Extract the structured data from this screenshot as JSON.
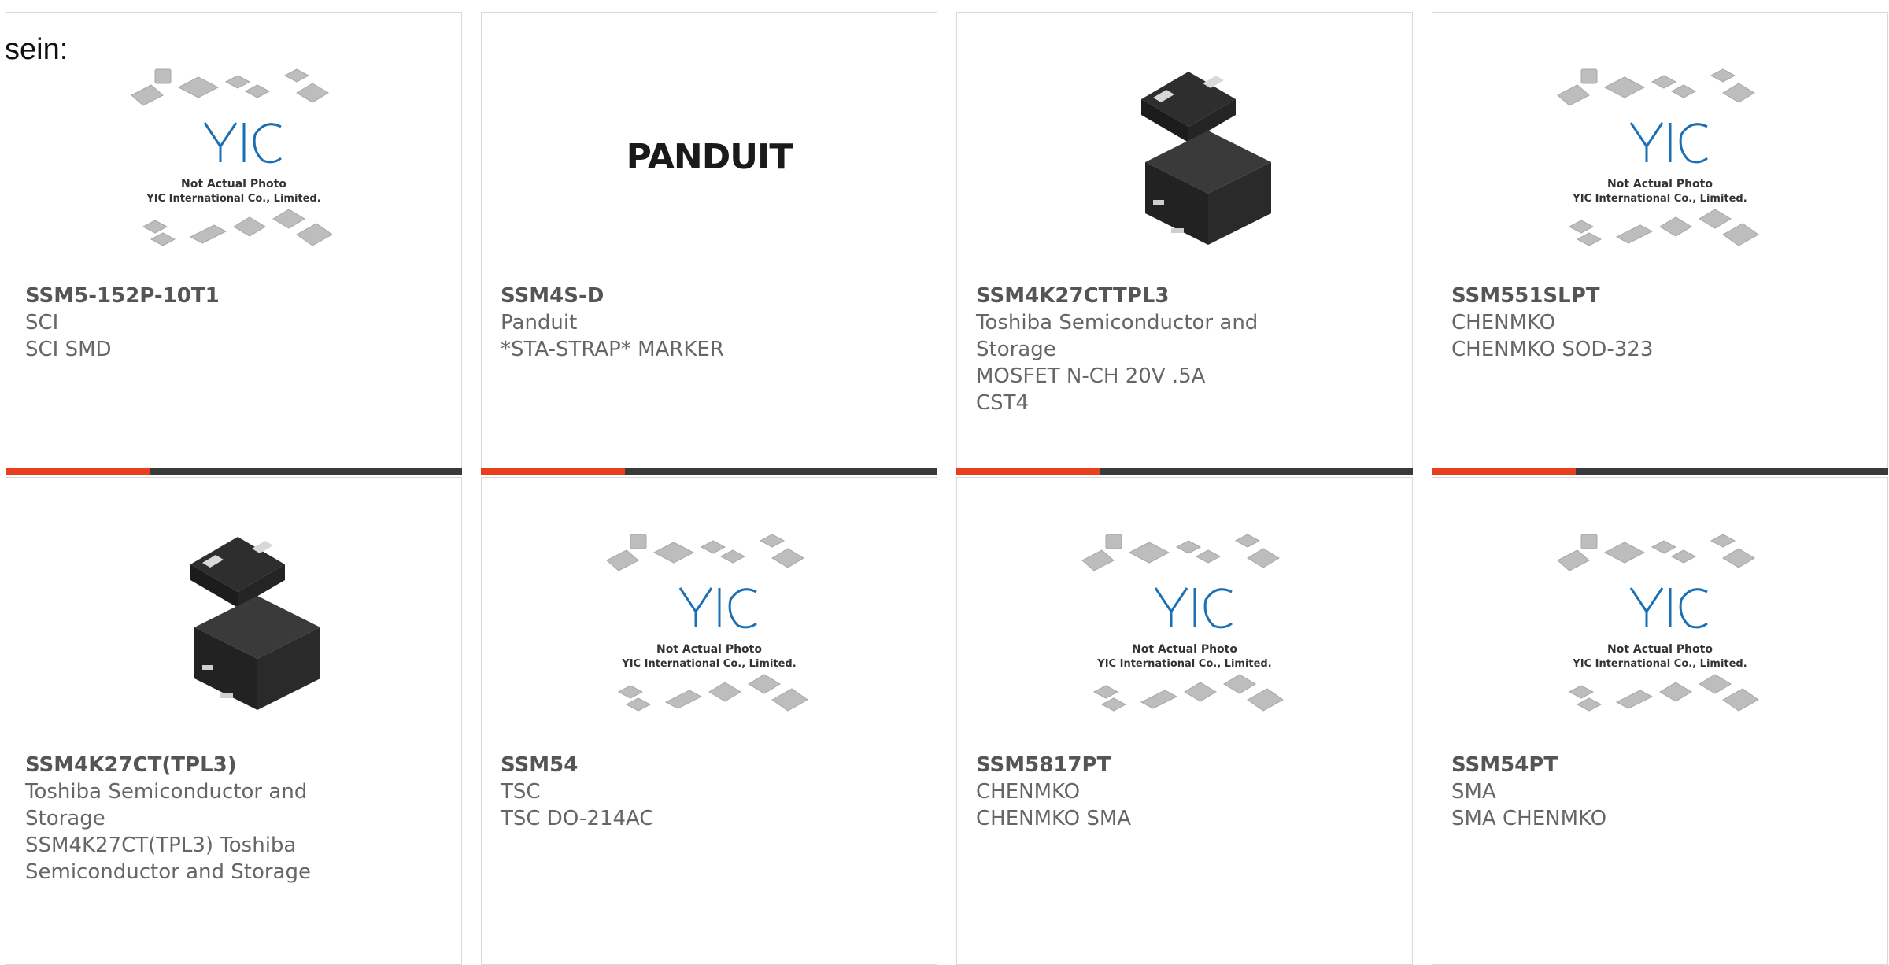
{
  "lead_text": "sein:",
  "colors": {
    "accent": "#e8401c",
    "bar_dark": "#3a3a3a",
    "card_border": "#d9d9d9"
  },
  "products": [
    {
      "part_number": "SSM5-152P-10T1",
      "manufacturer": "SCI",
      "description": "SCI SMD",
      "image": "yic-placeholder",
      "image_text_1": "Not Actual Photo",
      "image_text_2": "YIC International Co., Limited."
    },
    {
      "part_number": "SSM4S-D",
      "manufacturer": "Panduit",
      "description": "*STA-STRAP* MARKER",
      "image": "panduit-logo",
      "logo_text": "PANDUIT"
    },
    {
      "part_number": "SSM4K27CTTPL3",
      "manufacturer": "Toshiba Semiconductor and Storage",
      "description": "MOSFET N-CH 20V .5A CST4",
      "image": "chip-photo"
    },
    {
      "part_number": "SSM551SLPT",
      "manufacturer": "CHENMKO",
      "description": "CHENMKO SOD-323",
      "image": "yic-placeholder",
      "image_text_1": "Not Actual Photo",
      "image_text_2": "YIC International Co., Limited."
    },
    {
      "part_number": "SSM4K27CT(TPL3)",
      "manufacturer": "Toshiba Semiconductor and Storage",
      "description": "SSM4K27CT(TPL3) Toshiba Semiconductor and Storage",
      "image": "chip-photo"
    },
    {
      "part_number": "SSM54",
      "manufacturer": "TSC",
      "description": "TSC DO-214AC",
      "image": "yic-placeholder",
      "image_text_1": "Not Actual Photo",
      "image_text_2": "YIC International Co., Limited."
    },
    {
      "part_number": "SSM5817PT",
      "manufacturer": "CHENMKO",
      "description": "CHENMKO SMA",
      "image": "yic-placeholder",
      "image_text_1": "Not Actual Photo",
      "image_text_2": "YIC International Co., Limited."
    },
    {
      "part_number": "SSM54PT",
      "manufacturer": "SMA",
      "description": "SMA CHENMKO",
      "image": "yic-placeholder",
      "image_text_1": "Not Actual Photo",
      "image_text_2": "YIC International Co., Limited."
    }
  ]
}
